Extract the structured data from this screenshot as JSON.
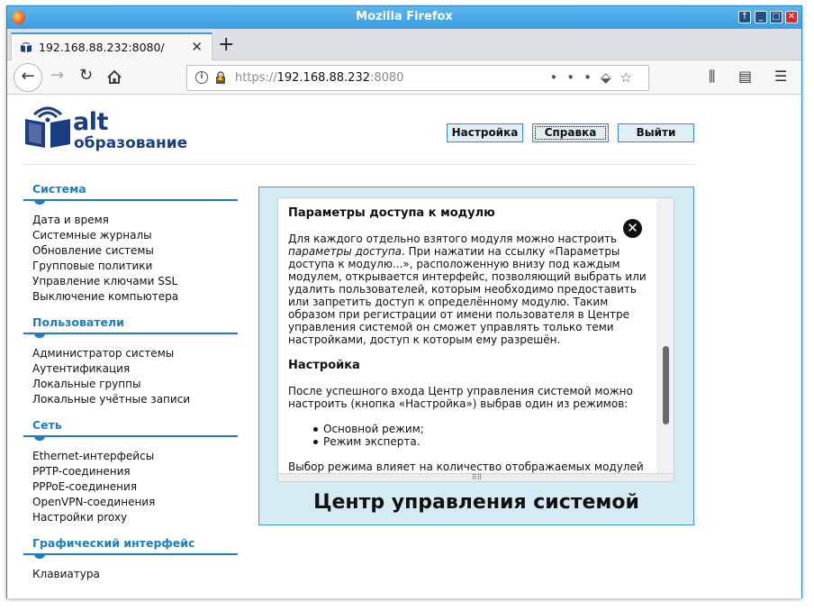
{
  "window": {
    "title": "Mozilla Firefox"
  },
  "browser": {
    "tab_title": "192.168.88.232:8080/",
    "url_scheme": "https://",
    "url_host": "192.168.88.232",
    "url_port": ":8080"
  },
  "header": {
    "logo_line1": "alt",
    "logo_line2": "образование",
    "buttons": [
      "Настройка",
      "Справка",
      "Выйти"
    ]
  },
  "sidebar": {
    "sections": [
      {
        "title": "Система",
        "items": [
          "Дата и время",
          "Системные журналы",
          "Обновление системы",
          "Групповые политики",
          "Управление ключами SSL",
          "Выключение компьютера"
        ]
      },
      {
        "title": "Пользователи",
        "items": [
          "Администратор системы",
          "Аутентификация",
          "Локальные группы",
          "Локальные учётные записи"
        ]
      },
      {
        "title": "Сеть",
        "items": [
          "Ethernet-интерфейсы",
          "PPTP-соединения",
          "PPPoE-соединения",
          "OpenVPN-соединения",
          "Настройки proxy"
        ]
      },
      {
        "title": "Графический интерфейс",
        "items": [
          "Клавиатура"
        ]
      }
    ]
  },
  "help": {
    "heading1": "Параметры доступа к модулю",
    "para1_a": "Для каждого отдельно взятого модуля можно настроить ",
    "para1_em": "параметры доступа",
    "para1_b": ". При нажатии на ссылку «Параметры доступа к модулю...», расположенную внизу под каждым модулем, открывается интерфейс, позволяющий выбрать или удалить пользователей, которым необходимо предоставить или запретить доступ к определённому модулю. Таким образом при регистрации от имени пользователя в Центре управления системой он сможет управлять только теми настройками, доступ к которым ему разрешён.",
    "heading2": "Настройка",
    "para2": "После успешного входа Центр управления системой можно настроить (кнопка «Настройка») выбрав один из режимов:",
    "list": [
      "Основной режим;",
      "Режим эксперта."
    ],
    "para3": "Выбор режима влияет на количество отображаемых модулей"
  },
  "main": {
    "title": "Центр управления системой"
  },
  "colors": {
    "accent": "#1a7fc0",
    "panel_bg": "#d5ebf4",
    "logo": "#1b3d82"
  }
}
